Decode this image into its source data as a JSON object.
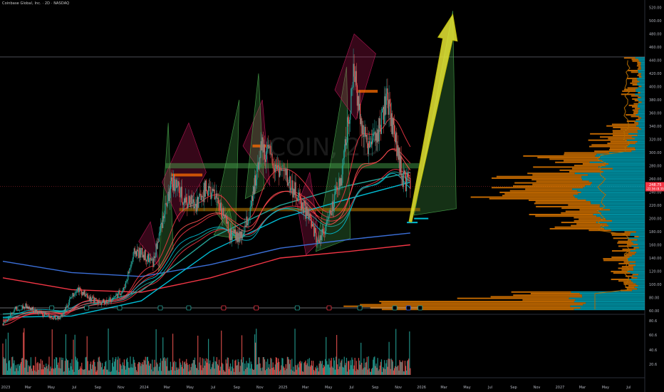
{
  "header": {
    "symbol_info": "Coinbase Global, Inc. · 2D · NASDAQ"
  },
  "watermark": "COIN, 2D",
  "price_tags": {
    "last_price": "248.75",
    "change": "-22.56 (8.35%)",
    "last_color": "#f23645"
  },
  "chart_data": [
    {
      "type": "candlestick",
      "title": "Coinbase Global, Inc. · 2D · NASDAQ",
      "y_axis_ticks": [
        520,
        500,
        480,
        460,
        440,
        420,
        400,
        380,
        360,
        340,
        320,
        300,
        280,
        260,
        240,
        220,
        200,
        180,
        160,
        140,
        120,
        100,
        80,
        60
      ],
      "ylim": [
        60,
        525
      ],
      "x_tick_labels": [
        "2023",
        "Mar",
        "May",
        "Jul",
        "Sep",
        "Nov",
        "2024",
        "Mar",
        "May",
        "Jul",
        "Sep",
        "Nov",
        "2025",
        "Mar",
        "May",
        "Jul",
        "Sep",
        "Nov",
        "2026",
        "Mar",
        "May",
        "Jul",
        "Sep",
        "Nov",
        "2027",
        "Mar",
        "May",
        "Jul"
      ],
      "price_path": {
        "dates": [
          "2023-01-01",
          "2023-02-01",
          "2023-03-01",
          "2023-04-01",
          "2023-05-01",
          "2023-06-01",
          "2023-06-20",
          "2023-07-15",
          "2023-08-15",
          "2023-09-15",
          "2023-10-15",
          "2023-11-15",
          "2023-12-15",
          "2024-01-10",
          "2024-02-01",
          "2024-03-01",
          "2024-03-25",
          "2024-04-20",
          "2024-05-20",
          "2024-06-20",
          "2024-07-25",
          "2024-08-20",
          "2024-09-20",
          "2024-10-15",
          "2024-11-10",
          "2024-12-10",
          "2025-01-15",
          "2025-02-15",
          "2025-03-15",
          "2025-04-10",
          "2025-05-10",
          "2025-06-10",
          "2025-07-15",
          "2025-08-15",
          "2025-09-10",
          "2025-10-10",
          "2025-11-01",
          "2025-11-20",
          "2025-12-10"
        ],
        "close": [
          40,
          62,
          68,
          58,
          52,
          48,
          70,
          95,
          80,
          72,
          78,
          92,
          150,
          145,
          132,
          210,
          258,
          230,
          220,
          245,
          225,
          175,
          170,
          210,
          310,
          290,
          265,
          235,
          205,
          165,
          200,
          260,
          420,
          310,
          320,
          380,
          320,
          260,
          250
        ]
      },
      "moving_averages": [
        {
          "color": "#3b6fd8",
          "dates": [
            "2023-01-01",
            "2023-07-01",
            "2024-01-01",
            "2024-07-01",
            "2025-01-01",
            "2025-07-01",
            "2025-12-10"
          ],
          "values": [
            135,
            118,
            112,
            130,
            155,
            168,
            178
          ]
        },
        {
          "color": "#f23645",
          "dates": [
            "2023-01-01",
            "2023-07-01",
            "2024-01-01",
            "2024-07-01",
            "2025-01-01",
            "2025-07-01",
            "2025-12-10"
          ],
          "values": [
            110,
            92,
            88,
            110,
            140,
            150,
            160
          ]
        },
        {
          "color": "#00bcd4",
          "dates": [
            "2023-01-01",
            "2023-07-01",
            "2024-01-01",
            "2024-07-01",
            "2025-01-01",
            "2025-07-01",
            "2025-12-10"
          ],
          "values": [
            50,
            52,
            75,
            150,
            200,
            230,
            255
          ]
        },
        {
          "color": "#26a69a",
          "dates": [
            "2023-01-01",
            "2023-07-01",
            "2024-01-01",
            "2024-07-01",
            "2025-01-01",
            "2025-07-01",
            "2025-12-10"
          ],
          "values": [
            55,
            60,
            90,
            170,
            220,
            250,
            270
          ]
        }
      ],
      "volume_axis_ticks": [
        "80.6",
        "60.6",
        "40.6",
        "20.6"
      ],
      "volume_profile": "right-side histogram, cyan and orange",
      "annotations": {
        "projected_arrow": {
          "from_date": "2025-12-10",
          "from_price": 195,
          "to_date": "2026-04-01",
          "to_price": 510,
          "color": "#e6e635"
        },
        "horizontal_line_price": 445
      }
    }
  ]
}
